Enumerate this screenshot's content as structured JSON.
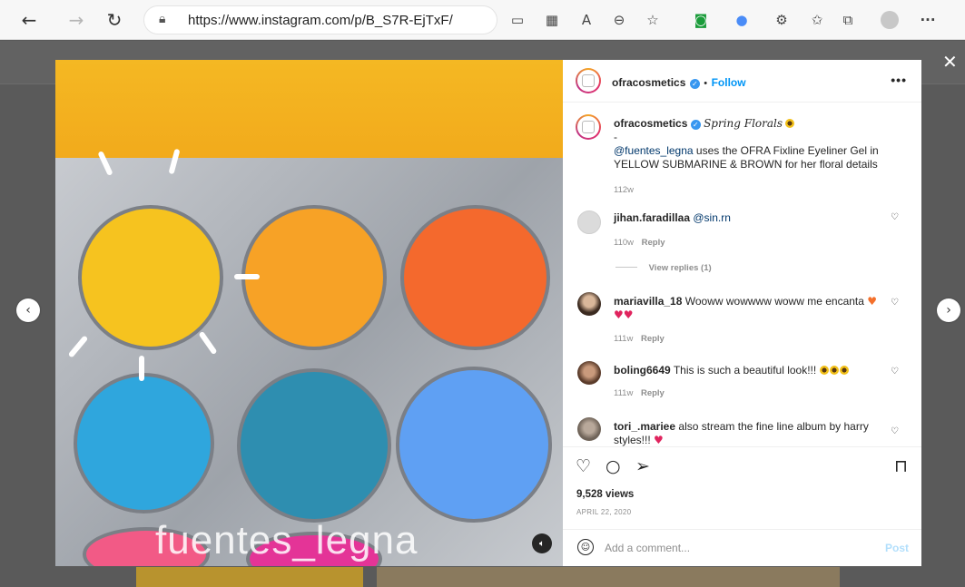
{
  "browser": {
    "url": "https://www.instagram.com/p/B_S7R-EjTxF/",
    "icons": {
      "back": "back-arrow-icon",
      "forward": "forward-arrow-icon",
      "refresh": "refresh-icon",
      "lock": "lock-icon"
    }
  },
  "post": {
    "author": "ofracosmetics",
    "follow_separator": "•",
    "follow_label": "Follow",
    "more": "•••",
    "video_overlay_text": "fuentes_legna",
    "caption": {
      "author": "ofracosmetics",
      "title": "Spring Florals",
      "dash": "-",
      "mention": "@fuentes_legna",
      "body": " uses the OFRA Fixline Eyeliner Gel in YELLOW SUBMARINE & BROWN for her floral details",
      "time": "112w"
    },
    "comments": [
      {
        "user": "jihan.faradillaa",
        "text": "@sin.rn",
        "time": "110w",
        "reply": "Reply",
        "view_replies": "View replies (1)"
      },
      {
        "user": "mariavilla_18",
        "text": "Wooww wowwww woww me encanta",
        "time": "111w",
        "reply": "Reply"
      },
      {
        "user": "boling6649",
        "text": "This is such a beautiful look!!!",
        "time": "111w",
        "reply": "Reply"
      },
      {
        "user": "tori_.mariee",
        "text": "also stream the fine line album by harry styles!!!",
        "time": "",
        "reply": ""
      }
    ],
    "views": "9,528 views",
    "date": "APRIL 22, 2020",
    "add_comment_placeholder": "Add a comment...",
    "post_label": "Post"
  },
  "colors": {
    "link_blue": "#0095f6",
    "verified_blue": "#3897f0",
    "mention": "#00376b"
  }
}
